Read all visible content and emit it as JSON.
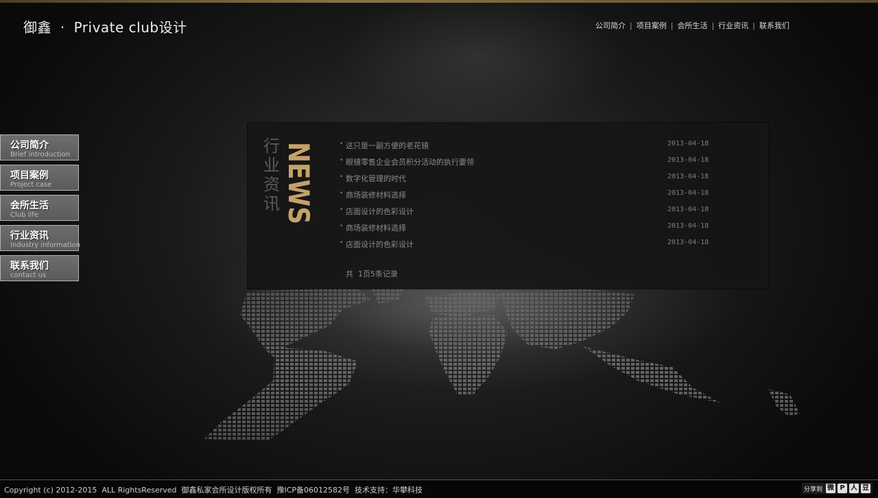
{
  "site": {
    "logo_brand": "御鑫",
    "logo_dot": "·",
    "logo_tail": "Private club设计"
  },
  "top_nav": {
    "items": [
      {
        "label": "公司简介"
      },
      {
        "label": "项目案例"
      },
      {
        "label": "会所生活"
      },
      {
        "label": "行业资讯"
      },
      {
        "label": "联系我们"
      }
    ],
    "separator": "|"
  },
  "side_nav": {
    "items": [
      {
        "label_cn": "公司简介",
        "label_en": "Brief introduction"
      },
      {
        "label_cn": "项目案例",
        "label_en": "Project case"
      },
      {
        "label_cn": "会所生活",
        "label_en": "Club life"
      },
      {
        "label_cn": "行业资讯",
        "label_en": "Industry information"
      },
      {
        "label_cn": "联系我们",
        "label_en": "contact us"
      }
    ]
  },
  "news_panel": {
    "title_cn_chars": [
      "行",
      "业",
      "资",
      "讯"
    ],
    "title_en": "NEWS",
    "title_en_color": "#c7a16a",
    "bullet": "•",
    "items": [
      {
        "title": "这只是一副方便的老花镜",
        "date": "2013-04-18"
      },
      {
        "title": "眼镜零售企业会员积分活动的执行要领",
        "date": "2013-04-18"
      },
      {
        "title": "数字化管理的时代",
        "date": "2013-04-18"
      },
      {
        "title": "商场装修材料选择",
        "date": "2013-04-18"
      },
      {
        "title": "店面设计的色彩设计",
        "date": "2013-04-18"
      },
      {
        "title": "商场装修材料选择",
        "date": "2013-04-18"
      },
      {
        "title": "店面设计的色彩设计",
        "date": "2013-04-18"
      }
    ],
    "pager": "共  1页5条记录"
  },
  "footer": {
    "copyright": "Copyright (c) 2012-2015  ALL RightsReserved  御鑫私家会所设计版权所有  豫ICP备06012582号  技术支持：华攀科技",
    "share_label": "分享到",
    "share_icons": [
      {
        "icon": "weibo-icon",
        "glyph": "微"
      },
      {
        "icon": "qzone-icon",
        "glyph": "P"
      },
      {
        "icon": "renren-icon",
        "glyph": "人"
      },
      {
        "icon": "douban-icon",
        "glyph": "豆"
      }
    ]
  },
  "colors": {
    "accent_gold": "#c7a16a",
    "background": "#0c0c0c",
    "side_button": "#646464"
  }
}
